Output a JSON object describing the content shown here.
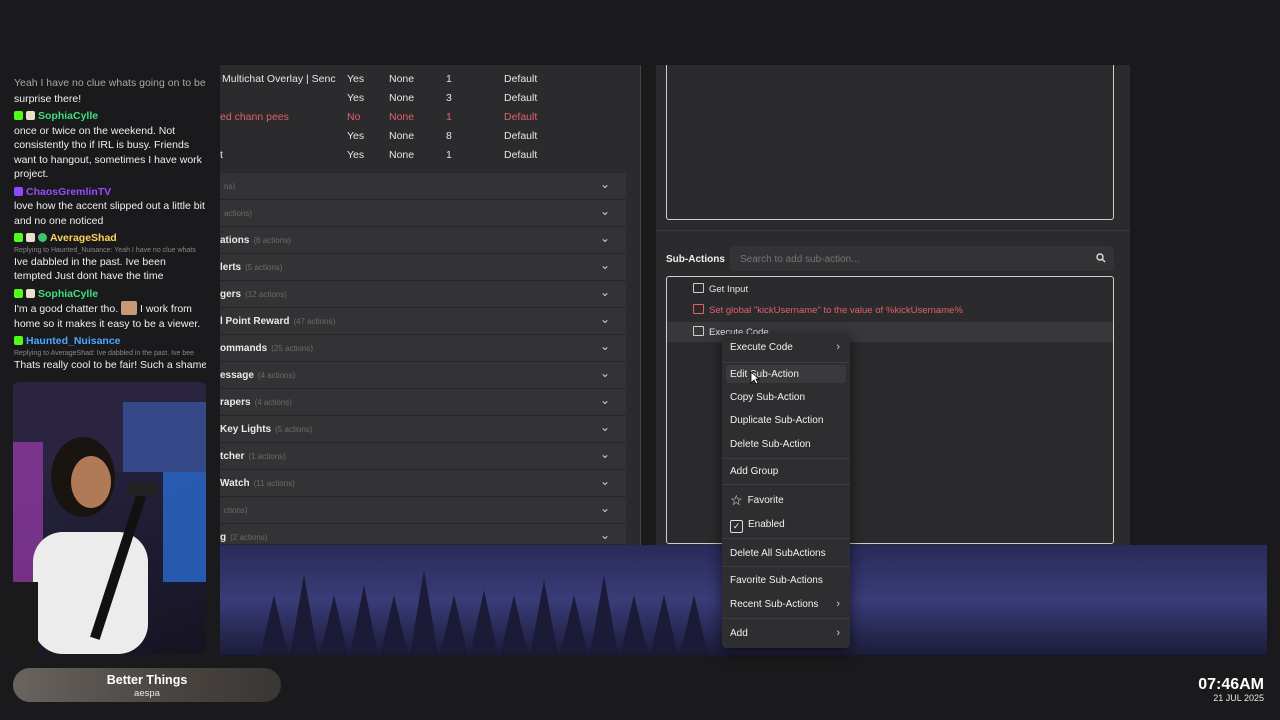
{
  "chat": {
    "messages": [
      {
        "user": "",
        "text": "Yeah I have no clue whats going on to be",
        "faded": true
      },
      {
        "user": "",
        "text": "surprise there!",
        "faded": false
      },
      {
        "user": "SophiaCylle",
        "color": "#3ee07a",
        "badges": [
          "kick",
          "user"
        ],
        "text": "once or twice on the weekend. Not consistently tho if IRL is busy. Friends want to hangout, sometimes I have work project."
      },
      {
        "user": "ChaosGremlinTV",
        "color": "#9b4bff",
        "badges": [
          "twitch"
        ],
        "text": "love how the accent slipped out a little bit and no one noticed"
      },
      {
        "user": "AverageShad",
        "color": "#ffd45a",
        "badges": [
          "kick",
          "user",
          "verified"
        ],
        "reply": "Replying to Haunted_Nuisance: Yeah I have no clue whats",
        "text": "Ive dabbled in the past. Ive been tempted Just dont have the time"
      },
      {
        "user": "SophiaCylle",
        "color": "#3ee07a",
        "badges": [
          "kick",
          "user"
        ],
        "text_before": "I'm a good chatter tho.",
        "text_after": "I work from home so it makes it easy to be a viewer."
      },
      {
        "user": "Haunted_Nuisance",
        "color": "#4aa8ff",
        "badges": [
          "kick"
        ],
        "reply": "Replying to AverageShad: Ive dabbled in the past. Ive bee",
        "text": "Thats really cool to be fair! Such a shame t"
      }
    ]
  },
  "actions_table": {
    "rows": [
      {
        "name": "Multichat Overlay | Senc",
        "enabled": "Yes",
        "group": "None",
        "count": "1",
        "queue": "Default",
        "error": false
      },
      {
        "name": "",
        "enabled": "Yes",
        "group": "None",
        "count": "3",
        "queue": "Default",
        "error": false
      },
      {
        "name": "ed chann pees",
        "enabled": "No",
        "group": "None",
        "count": "1",
        "queue": "Default",
        "error": true
      },
      {
        "name": "",
        "enabled": "Yes",
        "group": "None",
        "count": "8",
        "queue": "Default",
        "error": false
      },
      {
        "name": "t",
        "enabled": "Yes",
        "group": "None",
        "count": "1",
        "queue": "Default",
        "error": false
      }
    ],
    "groups": [
      {
        "label": "",
        "count": "ns)"
      },
      {
        "label": "",
        "count": "actions)"
      },
      {
        "label": "ations",
        "count": "(6 actions)"
      },
      {
        "label": "lerts",
        "count": "(5 actions)"
      },
      {
        "label": "gers",
        "count": "(12 actions)"
      },
      {
        "label": "l Point Reward",
        "count": "(47 actions)"
      },
      {
        "label": "ommands",
        "count": "(25 actions)"
      },
      {
        "label": "essage",
        "count": "(4 actions)"
      },
      {
        "label": "rapers",
        "count": "(4 actions)"
      },
      {
        "label": "Key Lights",
        "count": "(5 actions)"
      },
      {
        "label": "tcher",
        "count": "(1 actions)"
      },
      {
        "label": "Watch",
        "count": "(11 actions)"
      },
      {
        "label": "",
        "count": "ctions)"
      },
      {
        "label": "g",
        "count": "(2 actions)"
      }
    ]
  },
  "sub_actions": {
    "label": "Sub-Actions",
    "search_placeholder": "Search to add sub-action...",
    "items": [
      {
        "text": "Get Input",
        "error": false
      },
      {
        "text": "Set global \"kickUsername\" to the value of %kickUsername%",
        "error": true
      },
      {
        "text": "Execute Code",
        "error": false
      }
    ]
  },
  "context_menu": {
    "items": [
      {
        "label": "Execute Code",
        "submenu": true
      },
      {
        "label": "Edit Sub-Action"
      },
      {
        "label": "Copy Sub-Action"
      },
      {
        "label": "Duplicate Sub-Action"
      },
      {
        "label": "Delete Sub-Action"
      },
      {
        "label": "Add Group"
      },
      {
        "label": "Favorite"
      },
      {
        "label": "Enabled"
      },
      {
        "label": "Delete All SubActions"
      },
      {
        "label": "Favorite Sub-Actions"
      },
      {
        "label": "Recent Sub-Actions",
        "submenu": true
      },
      {
        "label": "Add",
        "submenu": true
      }
    ]
  },
  "now_playing": {
    "title": "Better Things",
    "artist": "aespa"
  },
  "clock": {
    "time": "07:46AM",
    "date": "21 JUL 2025"
  },
  "colors": {
    "error": "#e0606a",
    "panel": "#2b2b2d",
    "menu": "#2e2e30"
  }
}
